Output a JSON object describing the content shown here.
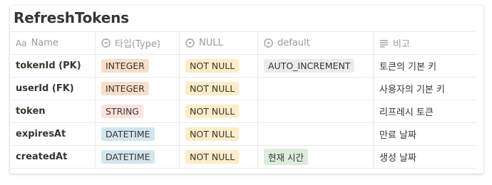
{
  "title": "RefreshTokens",
  "headers": {
    "name": {
      "prefix": "Aa",
      "label": "Name"
    },
    "type": "타입(Type)",
    "null": "NULL",
    "default": "default",
    "note": "비고"
  },
  "rows": [
    {
      "name": "tokenId (PK)",
      "type": "INTEGER",
      "null": "NOT NULL",
      "default": "AUTO_INCREMENT",
      "note": "토큰의 기본 키"
    },
    {
      "name": "userId (FK)",
      "type": "INTEGER",
      "null": "NOT NULL",
      "default": "",
      "note": "사용자의 기본 키"
    },
    {
      "name": "token",
      "type": "STRING",
      "null": "NOT NULL",
      "default": "",
      "note": "리프레시 토큰"
    },
    {
      "name": "expiresAt",
      "type": "DATETIME",
      "null": "NOT NULL",
      "default": "",
      "note": "만료 날짜"
    },
    {
      "name": "createdAt",
      "type": "DATETIME",
      "null": "NOT NULL",
      "default": "현재 시간",
      "note": "생성 날짜"
    }
  ],
  "colors": {
    "INTEGER": "#fadec9",
    "STRING": "#ffe2dd",
    "DATETIME": "#d3e5ef",
    "NOT NULL": "#fdecc8",
    "AUTO_INCREMENT": "#ececec",
    "현재 시간": "#dbeddb"
  }
}
